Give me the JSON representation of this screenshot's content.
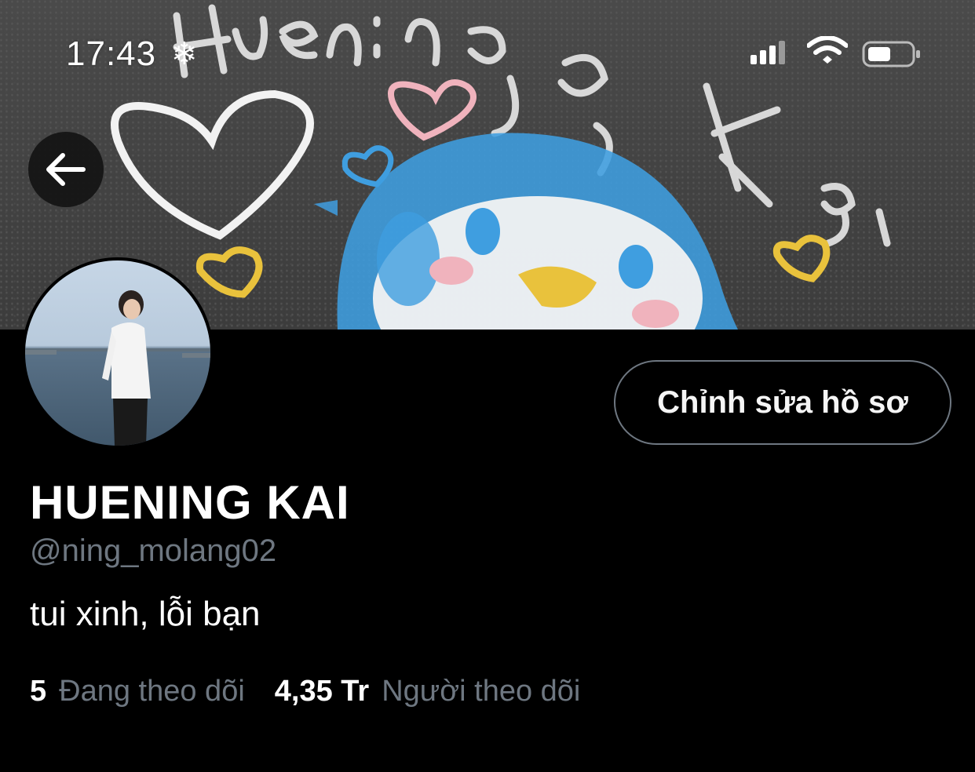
{
  "status_bar": {
    "time": "17:43",
    "snow_glyph": "❄"
  },
  "header": {
    "back_icon": "arrow-left-icon"
  },
  "profile": {
    "edit_button_label": "Chỉnh sửa hồ sơ",
    "display_name": "HUENING KAI",
    "handle": "@ning_molang02",
    "bio": "tui xinh, lỗi bạn",
    "following_count": "5",
    "following_label": "Đang theo dõi",
    "followers_count": "4,35 Tr",
    "followers_label": "Người theo dõi"
  },
  "colors": {
    "background": "#000000",
    "secondary_text": "#6e7781",
    "button_border": "#6e7781",
    "chalk_blue": "#3f9ee0",
    "chalk_yellow": "#e9c23c",
    "chalk_pink": "#f0b3bd"
  }
}
